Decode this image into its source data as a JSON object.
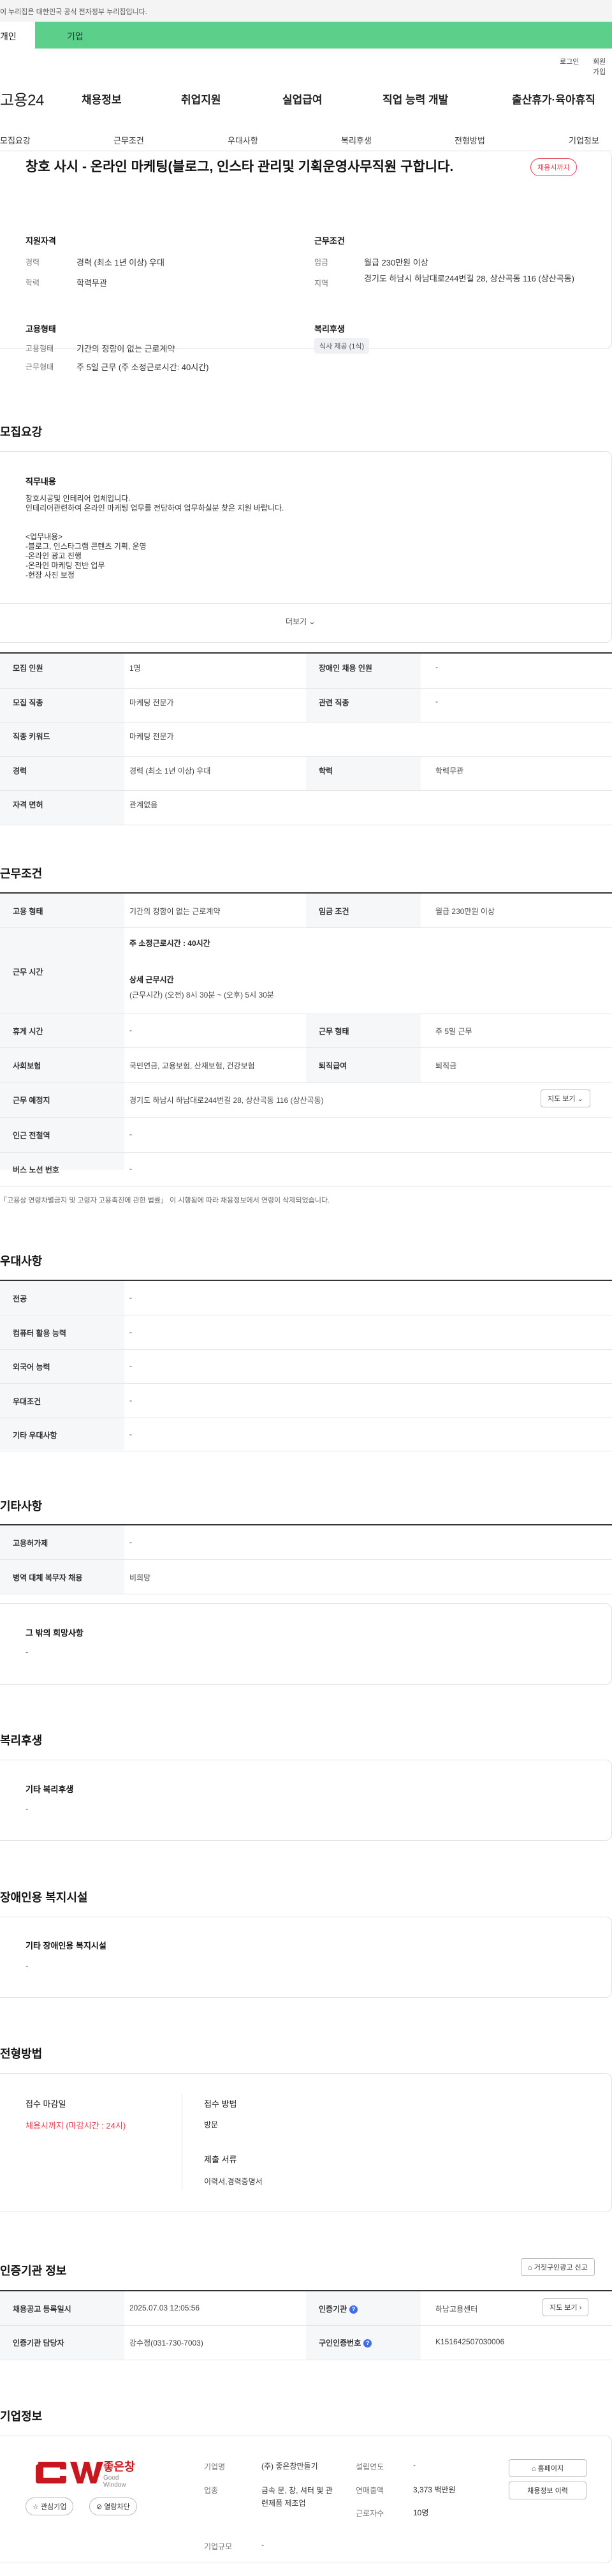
{
  "gov_notice": "이 누리집은 대한민국 공식 전자정부 누리집입니다.",
  "user_tabs": [
    "개인",
    "기업"
  ],
  "util": [
    "로그인",
    "회원가입"
  ],
  "logo": "고용24",
  "gnb": [
    "채용정보",
    "취업지원",
    "실업급여",
    "직업 능력 개발",
    "출산휴가·육아휴직"
  ],
  "subnav": [
    "모집요강",
    "근무조건",
    "우대사항",
    "복리후생",
    "전형방법",
    "기업정보"
  ],
  "job": {
    "title": "창호 사시 - 온라인 마케팅(블로그, 인스타 관리및 기획운영사무직원 구합니다.",
    "badge": "채용시까지",
    "qual_title": "지원자격",
    "cond_title": "근무조건",
    "career_label": "경력",
    "career": "경력 (최소 1년 이상) 우대",
    "edu_label": "학력",
    "edu": "학력무관",
    "wage_label": "임금",
    "wage": "월급 230만원 이상",
    "region_label": "지역",
    "region": "경기도 하남시 하남대로244번길 28, 상산곡동 116 (상산곡동)",
    "emp_title": "고용형태",
    "emp_type_label": "고용형태",
    "emp_type": "기간의 정함이 없는 근로계약",
    "work_type_label": "근무형태",
    "work_type": "주 5일 근무 (주 소정근로시간: 40시간)",
    "welfare_title": "복리후생",
    "welfare_pill": "식사 제공 (1식)"
  },
  "recruit": {
    "title": "모집요강",
    "duty_title": "직무내용",
    "duty_lines": [
      "창호시공및 인테리어 업체입니다.",
      "인테리어관련하여 온라인 마케팅 업무를 전담하여 업무하실분 찾은 지원 바랍니다.",
      "",
      "<업무내용>",
      "-블로그, 인스타그램 콘텐츠 기획, 운영",
      "-온라인 광고 진행",
      "-온라인 마케팅 전반 업무",
      "-현장 사진 보정"
    ],
    "more": "더보기",
    "rows": [
      {
        "th1": "모집 인원",
        "td1": "1명",
        "th2": "장애인 채용 인원",
        "td2": "-"
      },
      {
        "th1": "모집 직종",
        "td1": "마케팅 전문가",
        "th2": "관련 직종",
        "td2": "-"
      },
      {
        "th1": "직종 키워드",
        "td1": "마케팅 전문가",
        "th2": "",
        "td2": ""
      },
      {
        "th1": "경력",
        "td1": "경력 (최소 1년 이상) 우대",
        "th2": "학력",
        "td2": "학력무관"
      },
      {
        "th1": "자격 면허",
        "td1": "관계없음",
        "th2": "",
        "td2": ""
      }
    ]
  },
  "conditions": {
    "title": "근무조건",
    "emp_type_th": "고용 형태",
    "emp_type": "기간의 정함이 없는 근로계약",
    "wage_th": "임금 조건",
    "wage": "월급 230만원 이상",
    "hours_th": "근무 시간",
    "hours_main": "주 소정근로시간 : 40시간",
    "hours_detail_title": "상세 근무시간",
    "hours_detail": "(근무시간) (오전) 8시 30분 ~ (오후) 5시 30분",
    "break_th": "휴게 시간",
    "break": "-",
    "work_form_th": "근무 형태",
    "work_form": "주 5일 근무",
    "insurance_th": "사회보험",
    "insurance": "국민연금, 고용보험, 산재보험, 건강보험",
    "severance_th": "퇴직급여",
    "severance": "퇴직금",
    "place_th": "근무 예정지",
    "place": "경기도 하남시 하남대로244번길 28, 상산곡동 116 (상산곡동)",
    "map_btn": "지도 보기",
    "subway_th": "인근 전철역",
    "subway": "-",
    "bus_th": "버스 노선 번호",
    "bus": "-",
    "note": "「고용상 연령차별금지 및 고령자 고용촉진에 관한 법률」 이 시행됨에 따라 채용정보에서 연령이 삭제되었습니다."
  },
  "preference": {
    "title": "우대사항",
    "rows": [
      {
        "th": "전공",
        "td": "-"
      },
      {
        "th": "컴퓨터 활용 능력",
        "td": "-"
      },
      {
        "th": "외국어 능력",
        "td": "-"
      },
      {
        "th": "우대조건",
        "td": "-"
      },
      {
        "th": "기타 우대사항",
        "td": "-"
      }
    ]
  },
  "etc": {
    "title": "기타사항",
    "rows": [
      {
        "th": "고용허가제",
        "td": "-"
      },
      {
        "th": "병역 대체 복무자 채용",
        "td": "비희망"
      }
    ],
    "other_title": "그 밖의 희망사항",
    "other": "-"
  },
  "welfare": {
    "title": "복리후생",
    "sub": "기타 복리후생",
    "val": "-"
  },
  "disabled": {
    "title": "장애인용 복지시설",
    "sub": "기타 장애인용 복지시설",
    "val": "-"
  },
  "screening": {
    "title": "전형방법",
    "deadline_title": "접수 마감일",
    "deadline": "채용시까지 (마감시간 : 24시)",
    "method_title": "접수 방법",
    "method": "방문",
    "docs_title": "제출 서류",
    "docs": "이력서,경력증명서"
  },
  "agency": {
    "title": "인증기관 정보",
    "report_btn": "거짓구인광고 신고",
    "reg_date_th": "채용공고 등록일시",
    "reg_date": "2025.07.03 12:05:56",
    "agency_th": "인증기관",
    "agency": "하남고용센터",
    "map_btn": "지도 보기",
    "manager_th": "인증기관 담당자",
    "manager": "강수정(031-730-7003)",
    "job_no_th": "구인인증번호",
    "job_no": "K151642507030006"
  },
  "company": {
    "title": "기업정보",
    "logo_text": "좋은창",
    "logo_sub": "Good Window",
    "fav_btn": "관심기업",
    "block_btn": "열람차단",
    "name_th": "기업명",
    "name": "(주) 좋은창만들기",
    "industry_th": "업종",
    "industry": "금속 문, 창, 셔터 및 관련제품 제조업",
    "founded_th": "설립연도",
    "founded": "-",
    "revenue_th": "연매출액",
    "revenue": "3,373 백만원",
    "employees_th": "근로자수",
    "employees": "10명",
    "size_th": "기업규모",
    "size": "-",
    "home_btn": "홈페이지",
    "jobs_btn": "채용정보 이력"
  },
  "colors": {
    "accent_red": "#e53950",
    "brand_green": "#5ccf8a",
    "info_blue": "#3f6ee8"
  }
}
